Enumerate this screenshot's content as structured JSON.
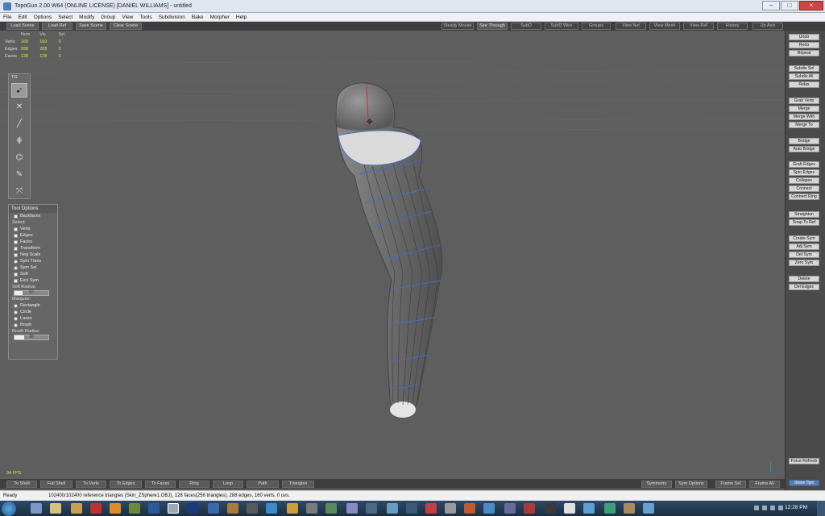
{
  "window": {
    "title": "TopoGun 2.00 W64  (ONLINE LICENSE)  [DANIEL WILLIAMS] - untitled",
    "controls": [
      "–",
      "□",
      "×"
    ]
  },
  "menu": [
    "File",
    "Edit",
    "Options",
    "Select",
    "Modify",
    "Group",
    "View",
    "Tools",
    "Subdivision",
    "Bake",
    "Morpher",
    "Help"
  ],
  "top_toolbar": {
    "left": [
      "Load Scene",
      "Load Ref",
      "Save Scene",
      "Clear Scene"
    ],
    "right": [
      "Steady Mouse",
      "See Through",
      "SubD",
      "SubD Wire",
      "Groups",
      "View Net",
      "View Mesh",
      "View Ref",
      "History",
      "Up Axis"
    ]
  },
  "stats": {
    "headers": [
      "Num",
      "Vis",
      "Sel"
    ],
    "rows": [
      {
        "label": "Verts",
        "num": "160",
        "vis": "160",
        "sel": "0"
      },
      {
        "label": "Edges",
        "num": "288",
        "vis": "288",
        "sel": "0"
      },
      {
        "label": "Faces",
        "num": "128",
        "vis": "128",
        "sel": "0"
      }
    ]
  },
  "toolbox": {
    "title": "TG",
    "icons": [
      "select-tool-icon",
      "cut-tool-icon",
      "draw-tool-icon",
      "brush-tool-icon",
      "tubes-tool-icon",
      "paint-tool-icon",
      "extrude-tool-icon"
    ]
  },
  "tool_options": {
    "title": "Tool Options",
    "backfaces": "Backfaces",
    "select_label": "Select:",
    "select_items": [
      "Verts",
      "Edges",
      "Faces"
    ],
    "transform_items": [
      "Transform",
      "Neg Scale",
      "Sym Trans",
      "Sym Sel",
      "Soft",
      "Excl Sym"
    ],
    "soft_radius_label": "Soft Radius:",
    "soft_radius_value": "50",
    "marquee_label": "Marquee:",
    "marquee_items": [
      "Rectangle",
      "Circle",
      "Lasso",
      "Brush"
    ],
    "brush_radius_label": "Brush Radius:",
    "brush_radius_value": "30"
  },
  "viewport": {
    "fps": "34 FPS"
  },
  "right_panel": [
    "Undo",
    "Redo",
    "Repeat",
    "Subdiv Sel",
    "Subdiv All",
    "Relax",
    "Grab Verts",
    "Merge",
    "Merge With",
    "Merge To",
    "Bridge",
    "Auto Bridge",
    "Grab Edges",
    "Spin Edges",
    "Collapse",
    "Connect",
    "Connect Ring",
    "Straighten",
    "Snap To Ref",
    "Create Sym",
    "Adj Sym",
    "Del Sym",
    "Zero Sym",
    "Delete",
    "Del Edges",
    "Force Refresh",
    "Show Tips"
  ],
  "bottom_toolbar": {
    "left": [
      "To Shell",
      "Full Shell",
      "To Verts",
      "To Edges",
      "To Faces",
      "Ring",
      "Loop",
      "Path",
      "Triangles"
    ],
    "right": [
      "Symmetry",
      "Sym Options",
      "Frame Sel",
      "Frame All"
    ]
  },
  "status": {
    "ready": "Ready",
    "info": "102400/102400 reference triangles (Skin_ZSphere1.OBJ), 128 faces(256 triangles), 288 edges, 160 verts, 0 uvs."
  },
  "taskbar": {
    "clock": "12:28 PM"
  },
  "colors": {
    "stat_value": "#e9e23a",
    "viewport_bg": "#5e5e5e",
    "edge_blue": "#3a6fd0",
    "axis_red": "#d02a2a"
  }
}
